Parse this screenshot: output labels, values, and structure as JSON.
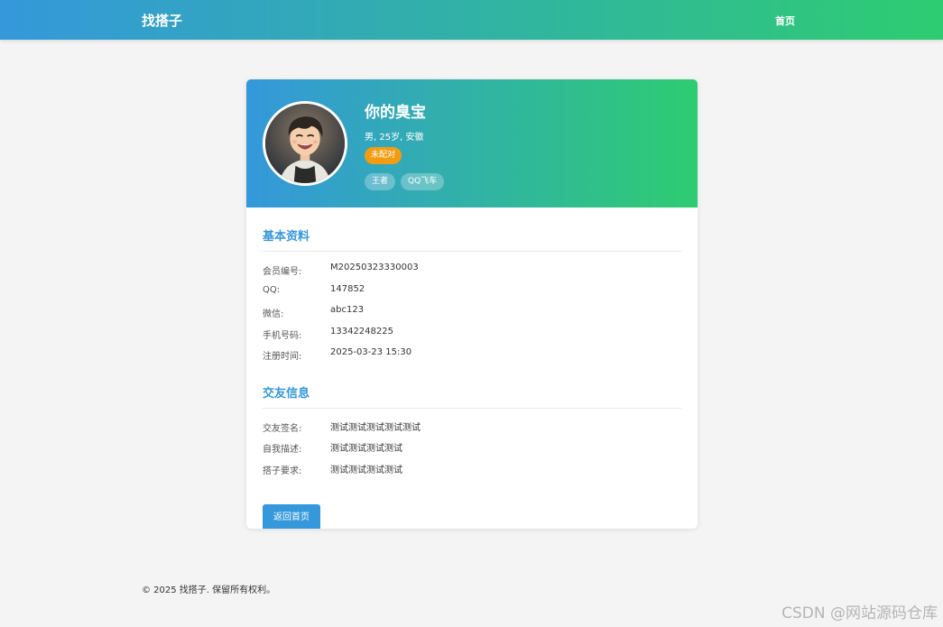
{
  "nav": {
    "brand": "找搭子",
    "home": "首页"
  },
  "profile": {
    "name": "你的臭宝",
    "meta": "男, 25岁, 安徽",
    "status": "未配对",
    "tags": [
      "王者",
      "QQ飞车"
    ]
  },
  "basic": {
    "title": "基本资料",
    "rows": [
      {
        "label": "会员编号:",
        "value": "M20250323330003"
      },
      {
        "label": "QQ:",
        "value": "147852"
      },
      {
        "label": "微信:",
        "value": "abc123"
      },
      {
        "label": "手机号码:",
        "value": "13342248225"
      },
      {
        "label": "注册时间:",
        "value": "2025-03-23 15:30"
      }
    ]
  },
  "social": {
    "title": "交友信息",
    "rows": [
      {
        "label": "交友签名:",
        "value": "测试测试测试测试测试"
      },
      {
        "label": "自我描述:",
        "value": "测试测试测试测试"
      },
      {
        "label": "搭子要求:",
        "value": "测试测试测试测试"
      }
    ]
  },
  "back_button": "返回首页",
  "footer": "© 2025 找搭子. 保留所有权利。",
  "watermark": "CSDN @网站源码仓库",
  "colors": {
    "brand_start": "#3498db",
    "brand_end": "#2ecc71",
    "badge": "#f39c12"
  }
}
